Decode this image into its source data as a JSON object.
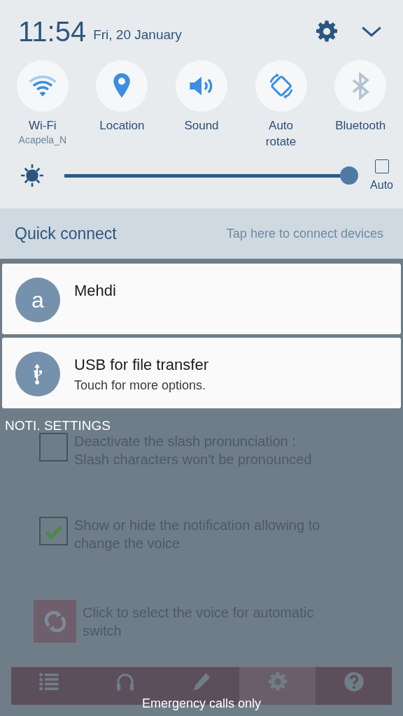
{
  "header": {
    "time": "11:54",
    "date": "Fri, 20 January"
  },
  "toggles": [
    {
      "kind": "wifi",
      "label": "Wi-Fi",
      "sublabel": "Acapela_N",
      "on": true
    },
    {
      "kind": "location",
      "label": "Location",
      "on": true
    },
    {
      "kind": "sound",
      "label": "Sound",
      "on": true
    },
    {
      "kind": "rotate",
      "label": "Auto\nrotate",
      "on": true
    },
    {
      "kind": "bluetooth",
      "label": "Bluetooth",
      "on": false
    }
  ],
  "brightness": {
    "level": 0.97,
    "auto_label": "Auto",
    "auto_checked": false
  },
  "quick_connect": {
    "title": "Quick connect",
    "hint": "Tap here to connect devices"
  },
  "notifications": [
    {
      "kind": "avatar",
      "letter": "a",
      "title": "Mehdi"
    },
    {
      "kind": "usb",
      "title": "USB for file transfer",
      "text": "Touch for more options."
    }
  ],
  "app": {
    "title": "NOTI. SETTINGS",
    "settings": [
      {
        "kind": "checkbox",
        "checked": false,
        "text": "Deactivate the slash pronunciation :\nSlash characters won't be pronounced"
      },
      {
        "kind": "checkbox",
        "checked": true,
        "text": "Show or hide the notification allowing to\nchange the voice"
      },
      {
        "kind": "action",
        "text": "Click to select the voice for automatic\nswitch"
      }
    ],
    "toolbar": [
      {
        "kind": "list",
        "selected": false
      },
      {
        "kind": "headphones",
        "selected": false
      },
      {
        "kind": "pencil",
        "selected": false
      },
      {
        "kind": "gear",
        "selected": true
      },
      {
        "kind": "help",
        "selected": false
      }
    ]
  },
  "emergency_text": "Emergency calls only"
}
